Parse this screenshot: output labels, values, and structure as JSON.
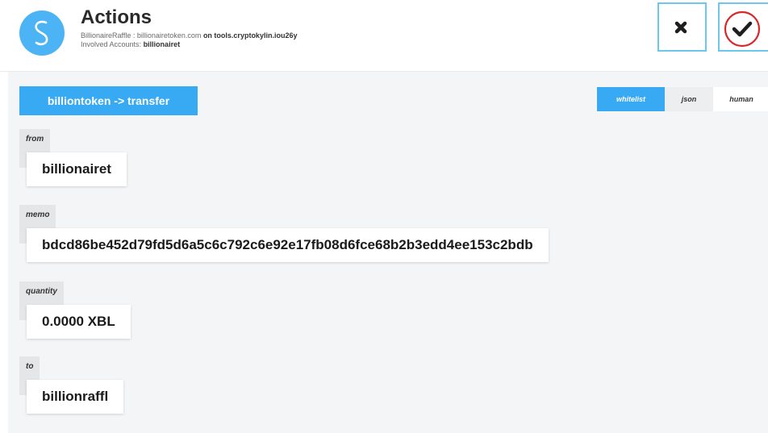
{
  "header": {
    "title": "Actions",
    "contract_line_prefix": "BillionaireRaffle : billionairetoken.com",
    "contract_line_on": "on tools.cryptokylin.iou26y",
    "involved_prefix": "Involved Accounts:",
    "involved_accounts": "billionairet"
  },
  "icons": {
    "logo": "app-logo-s",
    "cancel": "close-icon",
    "confirm": "check-icon"
  },
  "colors": {
    "accent": "#38a9f3",
    "logo_bg": "#4cb4f4",
    "button_border": "#6cc7ea",
    "highlight_circle": "#d9262a"
  },
  "action": {
    "title": "billiontoken -> transfer"
  },
  "view_tabs": {
    "selected": "whitelist",
    "items": [
      {
        "label": "whitelist"
      },
      {
        "label": "json"
      },
      {
        "label": "human"
      }
    ]
  },
  "fields": [
    {
      "label": "from",
      "value": "billionairet"
    },
    {
      "label": "memo",
      "value": "bdcd86be452d79fd5d6a5c6c792c6e92e17fb08d6fce68b2b3edd4ee153c2bdb"
    },
    {
      "label": "quantity",
      "value": "0.0000 XBL"
    },
    {
      "label": "to",
      "value": "billionraffl"
    }
  ]
}
